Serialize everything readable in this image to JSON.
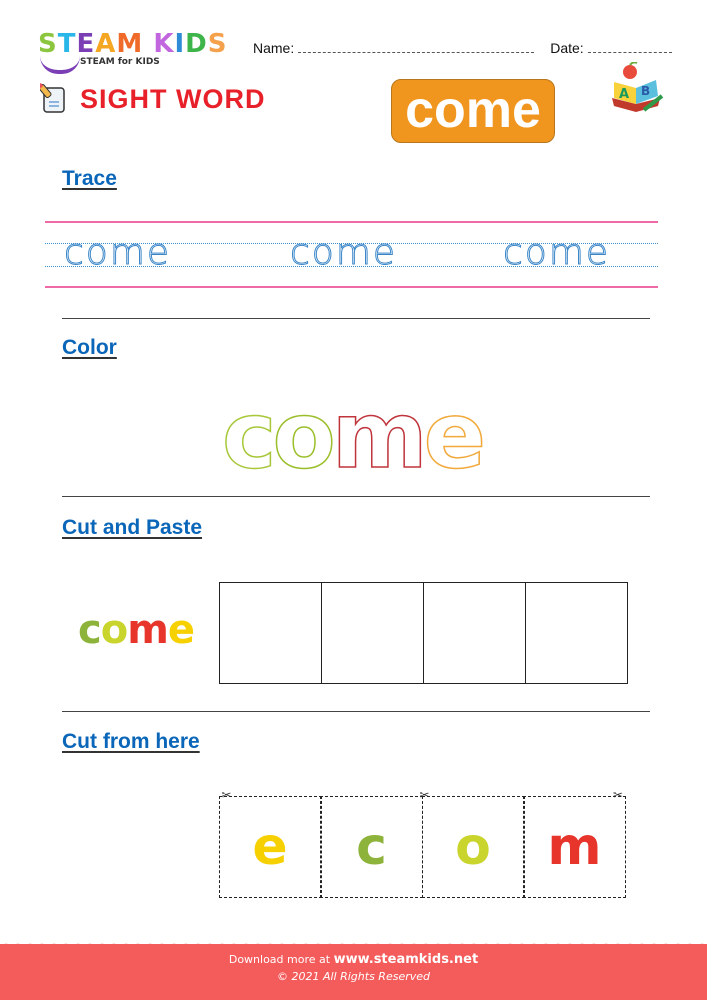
{
  "brand": {
    "logo_letters": [
      {
        "ch": "S",
        "color": "#8cc63f"
      },
      {
        "ch": "T",
        "color": "#29b6e8"
      },
      {
        "ch": "E",
        "color": "#7b3fb5"
      },
      {
        "ch": "A",
        "color": "#f5a623"
      },
      {
        "ch": "M",
        "color": "#f06a2a"
      },
      {
        "ch": " ",
        "color": "#fff"
      },
      {
        "ch": "K",
        "color": "#c266e0"
      },
      {
        "ch": "I",
        "color": "#2e8bd6"
      },
      {
        "ch": "D",
        "color": "#3db54a"
      },
      {
        "ch": "S",
        "color": "#f5a04a"
      }
    ],
    "tagline": "STEAM for KIDS"
  },
  "header": {
    "name_label": "Name:",
    "date_label": "Date:",
    "section_title": "SIGHT WORD",
    "sight_word": "come",
    "icons": {
      "worksheet": "pencil-paper-icon",
      "book": "abc-book-icon"
    }
  },
  "sections": {
    "trace": {
      "heading": "Trace",
      "words": [
        "come",
        "come",
        "come"
      ]
    },
    "color": {
      "heading": "Color",
      "word": "come",
      "letter_colors": [
        "#a8c83a",
        "#9bbf2a",
        "#c0343c",
        "#f2a93b"
      ]
    },
    "cut_paste": {
      "heading": "Cut and Paste",
      "word_letters": [
        {
          "ch": "c",
          "color": "#8db33a"
        },
        {
          "ch": "o",
          "color": "#c9d42c"
        },
        {
          "ch": "m",
          "color": "#e8352b"
        },
        {
          "ch": "e",
          "color": "#f7d000"
        }
      ],
      "box_count": 4
    },
    "cut_from": {
      "heading": "Cut from here",
      "letters": [
        {
          "ch": "e",
          "color": "#f7d000"
        },
        {
          "ch": "c",
          "color": "#8db33a"
        },
        {
          "ch": "o",
          "color": "#c9d42c"
        },
        {
          "ch": "m",
          "color": "#e8352b"
        }
      ]
    }
  },
  "footer": {
    "download_prefix": "Download more at",
    "site": "www.steamkids.net",
    "copyright": "© 2021 All Rights Reserved"
  }
}
